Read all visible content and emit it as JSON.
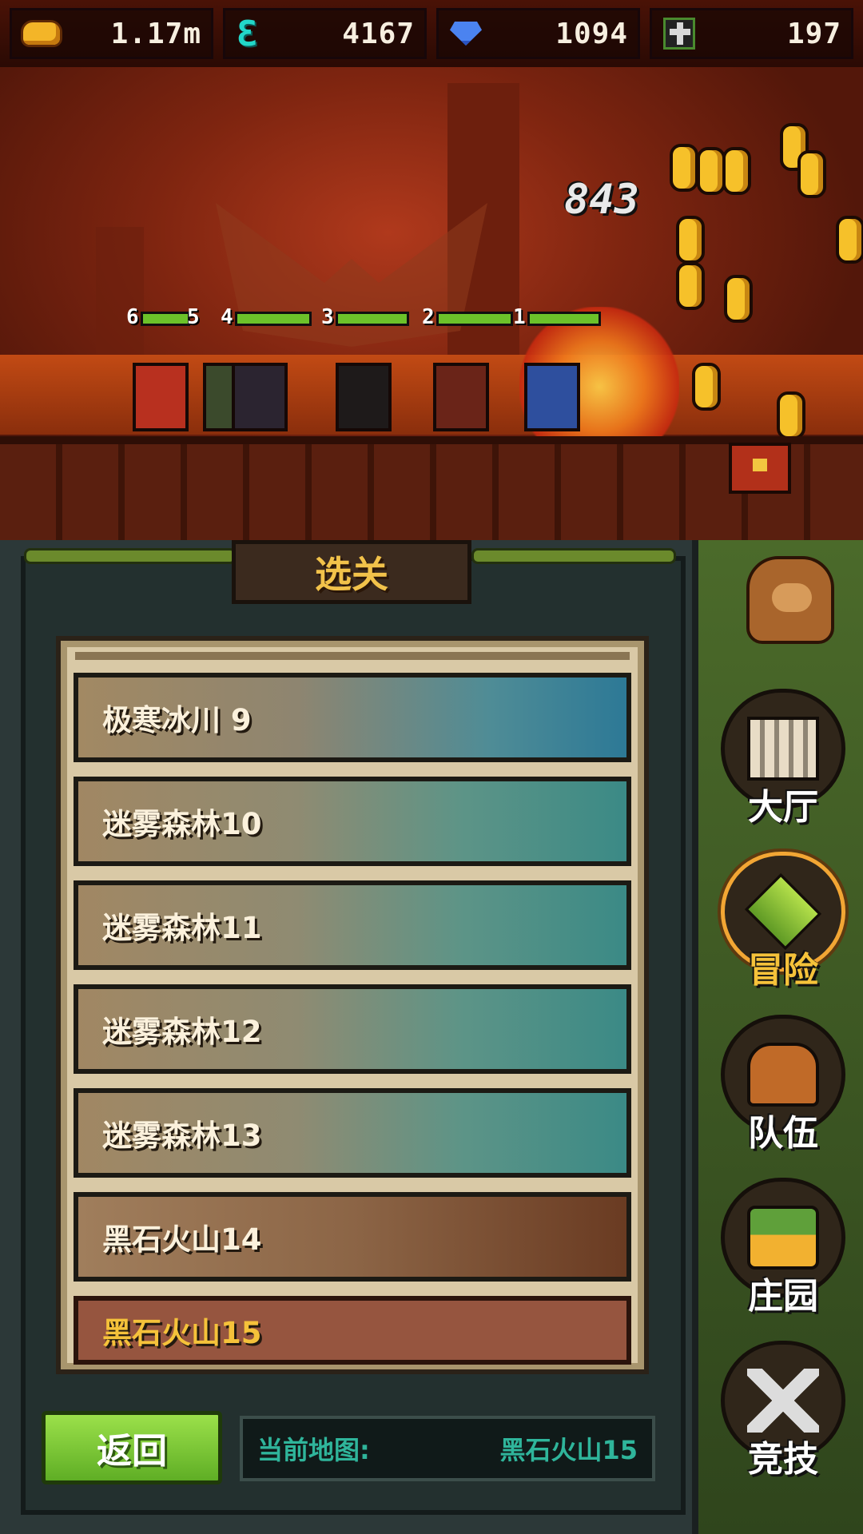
{
  "resources": [
    {
      "icon": "gold-icon",
      "value": "1.17m"
    },
    {
      "icon": "energy-icon",
      "value": "4167"
    },
    {
      "icon": "diamond-icon",
      "value": "1094"
    },
    {
      "icon": "cross-icon",
      "value": "197"
    }
  ],
  "scene": {
    "damage_number": "843",
    "hero_slots": [
      "6",
      "5",
      "4",
      "3",
      "2",
      "1"
    ]
  },
  "panel": {
    "title": "选关",
    "stages": [
      {
        "label": "极寒冰川  9",
        "theme": "ice"
      },
      {
        "label": "迷雾森林10",
        "theme": "forest"
      },
      {
        "label": "迷雾森林11",
        "theme": "forest"
      },
      {
        "label": "迷雾森林12",
        "theme": "forest"
      },
      {
        "label": "迷雾森林13",
        "theme": "forest"
      },
      {
        "label": "黑石火山14",
        "theme": "volcano"
      },
      {
        "label": "黑石火山15",
        "theme": "volcano-selected"
      }
    ],
    "back_label": "返回",
    "current_map_label": "当前地图:",
    "current_map_value": "黑石火山15"
  },
  "nav": [
    {
      "label": "大厅",
      "icon": "hall-icon"
    },
    {
      "label": "冒险",
      "icon": "adventure-icon",
      "active": true
    },
    {
      "label": "队伍",
      "icon": "team-icon"
    },
    {
      "label": "庄园",
      "icon": "estate-icon"
    },
    {
      "label": "竞技",
      "icon": "arena-icon"
    }
  ],
  "colors": {
    "accent": "#f5c23a",
    "back_button": "#7cc83a",
    "current_map_text": "#2fb59b"
  }
}
